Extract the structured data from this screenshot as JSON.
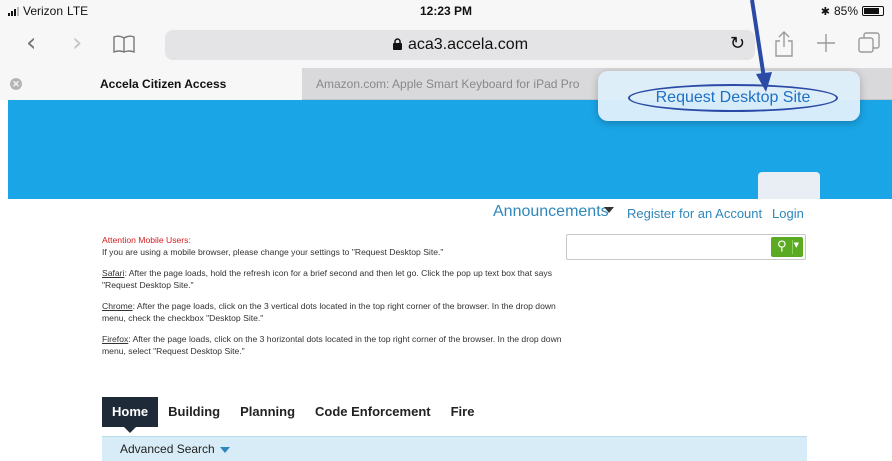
{
  "status_bar": {
    "carrier": "Verizon",
    "network": "LTE",
    "time": "12:23 PM",
    "bluetooth_icon": "bluetooth-icon",
    "battery": "85%",
    "battery_level": 0.85
  },
  "toolbar": {
    "back_icon": "chevron-left-icon",
    "forward_icon": "chevron-right-icon",
    "bookmarks_icon": "book-icon",
    "url": "aca3.accela.com",
    "lock_icon": "lock-icon",
    "reload_icon": "reload-icon",
    "share_icon": "share-icon",
    "new_tab_icon": "plus-icon",
    "tabs_icon": "tabs-icon"
  },
  "tabs": [
    {
      "label": "Accela Citizen Access",
      "active": true
    },
    {
      "label": "Amazon.com: Apple Smart Keyboard for iPad Pro 9....",
      "active": false
    }
  ],
  "popup": {
    "label": "Request Desktop Site"
  },
  "site_header": {
    "announcements": "Announcements",
    "register": "Register for an Account",
    "login": "Login"
  },
  "notice": {
    "attention": "Attention Mobile Users:",
    "intro": "If you are using a mobile browser, please change your settings to \"Request Desktop Site.\"",
    "safari_label": "Safari",
    "safari_text": ": After the page loads, hold the refresh icon for a brief second and then let go. Click the pop up text box that says \"Request Desktop Site.\"",
    "chrome_label": "Chrome",
    "chrome_text": ": After the page loads, click on the 3 vertical dots located in the top right corner of the browser. In the drop down menu, check the checkbox \"Desktop Site.\"",
    "firefox_label": "Firefox",
    "firefox_text": ": After the page loads, click on the 3 horizontal dots located in the top right corner of the browser. In the drop down menu, select \"Request Desktop Site.\""
  },
  "main_nav": {
    "items": [
      "Home",
      "Building",
      "Planning",
      "Code Enforcement",
      "Fire"
    ]
  },
  "sub_nav": {
    "advanced_search": "Advanced Search"
  },
  "colors": {
    "banner": "#1aa5e6",
    "link": "#2f87bb",
    "attention": "#d21d1d",
    "search_button": "#5aaa22",
    "nav_active": "#1e2a38",
    "annotation_arrow": "#2b4aa6"
  }
}
